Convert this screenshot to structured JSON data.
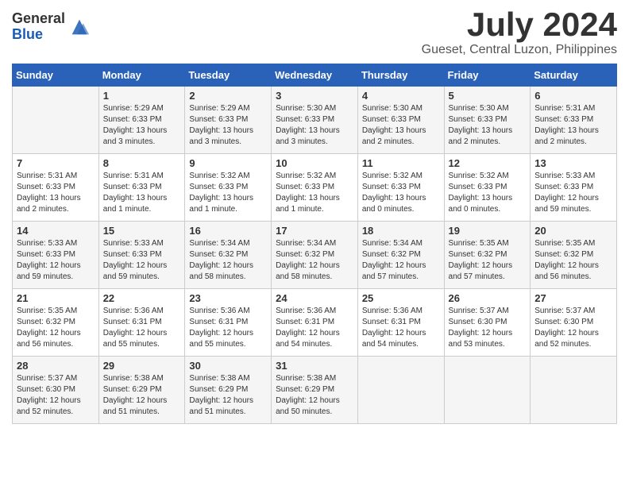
{
  "logo": {
    "general": "General",
    "blue": "Blue"
  },
  "title": "July 2024",
  "location": "Gueset, Central Luzon, Philippines",
  "days_header": [
    "Sunday",
    "Monday",
    "Tuesday",
    "Wednesday",
    "Thursday",
    "Friday",
    "Saturday"
  ],
  "weeks": [
    [
      {
        "day": "",
        "info": ""
      },
      {
        "day": "1",
        "info": "Sunrise: 5:29 AM\nSunset: 6:33 PM\nDaylight: 13 hours\nand 3 minutes."
      },
      {
        "day": "2",
        "info": "Sunrise: 5:29 AM\nSunset: 6:33 PM\nDaylight: 13 hours\nand 3 minutes."
      },
      {
        "day": "3",
        "info": "Sunrise: 5:30 AM\nSunset: 6:33 PM\nDaylight: 13 hours\nand 3 minutes."
      },
      {
        "day": "4",
        "info": "Sunrise: 5:30 AM\nSunset: 6:33 PM\nDaylight: 13 hours\nand 2 minutes."
      },
      {
        "day": "5",
        "info": "Sunrise: 5:30 AM\nSunset: 6:33 PM\nDaylight: 13 hours\nand 2 minutes."
      },
      {
        "day": "6",
        "info": "Sunrise: 5:31 AM\nSunset: 6:33 PM\nDaylight: 13 hours\nand 2 minutes."
      }
    ],
    [
      {
        "day": "7",
        "info": "Sunrise: 5:31 AM\nSunset: 6:33 PM\nDaylight: 13 hours\nand 2 minutes."
      },
      {
        "day": "8",
        "info": "Sunrise: 5:31 AM\nSunset: 6:33 PM\nDaylight: 13 hours\nand 1 minute."
      },
      {
        "day": "9",
        "info": "Sunrise: 5:32 AM\nSunset: 6:33 PM\nDaylight: 13 hours\nand 1 minute."
      },
      {
        "day": "10",
        "info": "Sunrise: 5:32 AM\nSunset: 6:33 PM\nDaylight: 13 hours\nand 1 minute."
      },
      {
        "day": "11",
        "info": "Sunrise: 5:32 AM\nSunset: 6:33 PM\nDaylight: 13 hours\nand 0 minutes."
      },
      {
        "day": "12",
        "info": "Sunrise: 5:32 AM\nSunset: 6:33 PM\nDaylight: 13 hours\nand 0 minutes."
      },
      {
        "day": "13",
        "info": "Sunrise: 5:33 AM\nSunset: 6:33 PM\nDaylight: 12 hours\nand 59 minutes."
      }
    ],
    [
      {
        "day": "14",
        "info": "Sunrise: 5:33 AM\nSunset: 6:33 PM\nDaylight: 12 hours\nand 59 minutes."
      },
      {
        "day": "15",
        "info": "Sunrise: 5:33 AM\nSunset: 6:33 PM\nDaylight: 12 hours\nand 59 minutes."
      },
      {
        "day": "16",
        "info": "Sunrise: 5:34 AM\nSunset: 6:32 PM\nDaylight: 12 hours\nand 58 minutes."
      },
      {
        "day": "17",
        "info": "Sunrise: 5:34 AM\nSunset: 6:32 PM\nDaylight: 12 hours\nand 58 minutes."
      },
      {
        "day": "18",
        "info": "Sunrise: 5:34 AM\nSunset: 6:32 PM\nDaylight: 12 hours\nand 57 minutes."
      },
      {
        "day": "19",
        "info": "Sunrise: 5:35 AM\nSunset: 6:32 PM\nDaylight: 12 hours\nand 57 minutes."
      },
      {
        "day": "20",
        "info": "Sunrise: 5:35 AM\nSunset: 6:32 PM\nDaylight: 12 hours\nand 56 minutes."
      }
    ],
    [
      {
        "day": "21",
        "info": "Sunrise: 5:35 AM\nSunset: 6:32 PM\nDaylight: 12 hours\nand 56 minutes."
      },
      {
        "day": "22",
        "info": "Sunrise: 5:36 AM\nSunset: 6:31 PM\nDaylight: 12 hours\nand 55 minutes."
      },
      {
        "day": "23",
        "info": "Sunrise: 5:36 AM\nSunset: 6:31 PM\nDaylight: 12 hours\nand 55 minutes."
      },
      {
        "day": "24",
        "info": "Sunrise: 5:36 AM\nSunset: 6:31 PM\nDaylight: 12 hours\nand 54 minutes."
      },
      {
        "day": "25",
        "info": "Sunrise: 5:36 AM\nSunset: 6:31 PM\nDaylight: 12 hours\nand 54 minutes."
      },
      {
        "day": "26",
        "info": "Sunrise: 5:37 AM\nSunset: 6:30 PM\nDaylight: 12 hours\nand 53 minutes."
      },
      {
        "day": "27",
        "info": "Sunrise: 5:37 AM\nSunset: 6:30 PM\nDaylight: 12 hours\nand 52 minutes."
      }
    ],
    [
      {
        "day": "28",
        "info": "Sunrise: 5:37 AM\nSunset: 6:30 PM\nDaylight: 12 hours\nand 52 minutes."
      },
      {
        "day": "29",
        "info": "Sunrise: 5:38 AM\nSunset: 6:29 PM\nDaylight: 12 hours\nand 51 minutes."
      },
      {
        "day": "30",
        "info": "Sunrise: 5:38 AM\nSunset: 6:29 PM\nDaylight: 12 hours\nand 51 minutes."
      },
      {
        "day": "31",
        "info": "Sunrise: 5:38 AM\nSunset: 6:29 PM\nDaylight: 12 hours\nand 50 minutes."
      },
      {
        "day": "",
        "info": ""
      },
      {
        "day": "",
        "info": ""
      },
      {
        "day": "",
        "info": ""
      }
    ]
  ]
}
